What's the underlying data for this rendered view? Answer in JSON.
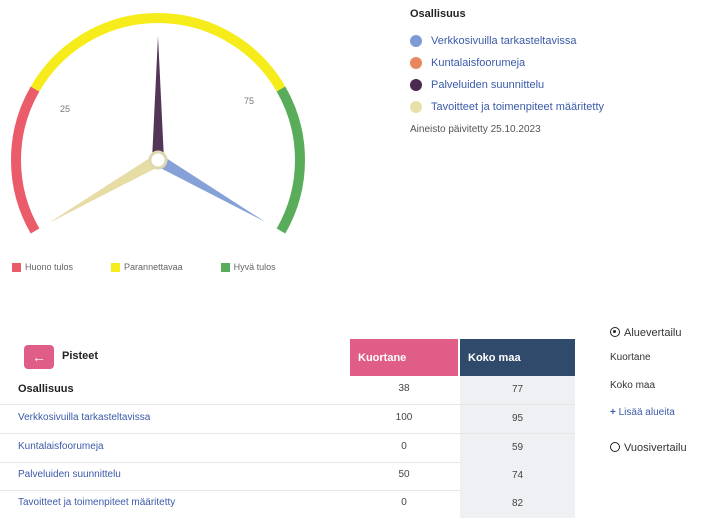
{
  "gauge": {
    "ticks": [
      "25",
      "75"
    ],
    "needles": [
      {
        "name": "Verkkosivuilla tarkasteltavissa",
        "value": 100,
        "color": "#7f9bd6"
      },
      {
        "name": "Kuntalaisfoorumeja",
        "value": 0,
        "color": "#e8875d"
      },
      {
        "name": "Palveluiden suunnittelu",
        "value": 50,
        "color": "#4a2a4e"
      },
      {
        "name": "Tavoitteet ja toimenpiteet määritetty",
        "value": 0,
        "color": "#e5e1a8"
      }
    ],
    "bands": [
      {
        "from": 0,
        "to": 25,
        "color": "#ea5c6a"
      },
      {
        "from": 25,
        "to": 75,
        "color": "#f6ec1c"
      },
      {
        "from": 75,
        "to": 100,
        "color": "#59ac5a"
      }
    ],
    "legend": [
      {
        "label": "Huono tulos",
        "color": "#ea5c6a"
      },
      {
        "label": "Parannettavaa",
        "color": "#f6ec1c"
      },
      {
        "label": "Hyvä tulos",
        "color": "#59ac5a"
      }
    ]
  },
  "legend": {
    "title": "Osallisuus",
    "items": [
      {
        "label": "Verkkosivuilla tarkasteltavissa",
        "color": "#7f9bd6"
      },
      {
        "label": "Kuntalaisfoorumeja",
        "color": "#e8875d"
      },
      {
        "label": "Palveluiden suunnittelu",
        "color": "#4a2a4e"
      },
      {
        "label": "Tavoitteet ja toimenpiteet määritetty",
        "color": "#e5e1a8"
      }
    ],
    "updated": "Aineisto päivitetty 25.10.2023"
  },
  "table": {
    "back_icon": "←",
    "points_label": "Pisteet",
    "col_a": "Kuortane",
    "col_b": "Koko maa",
    "rows": [
      {
        "label": "Osallisuus",
        "a": "38",
        "b": "77"
      },
      {
        "label": "Verkkosivuilla tarkasteltavissa",
        "a": "100",
        "b": "95"
      },
      {
        "label": "Kuntalaisfoorumeja",
        "a": "0",
        "b": "59"
      },
      {
        "label": "Palveluiden suunnittelu",
        "a": "50",
        "b": "74"
      },
      {
        "label": "Tavoitteet ja toimenpiteet määritetty",
        "a": "0",
        "b": "82"
      }
    ]
  },
  "comparison": {
    "area_label": "Aluevertailu",
    "areas": [
      "Kuortane",
      "Koko maa"
    ],
    "add_area": "Lisää alueita",
    "add_icon": "+",
    "year_label": "Vuosivertailu"
  }
}
